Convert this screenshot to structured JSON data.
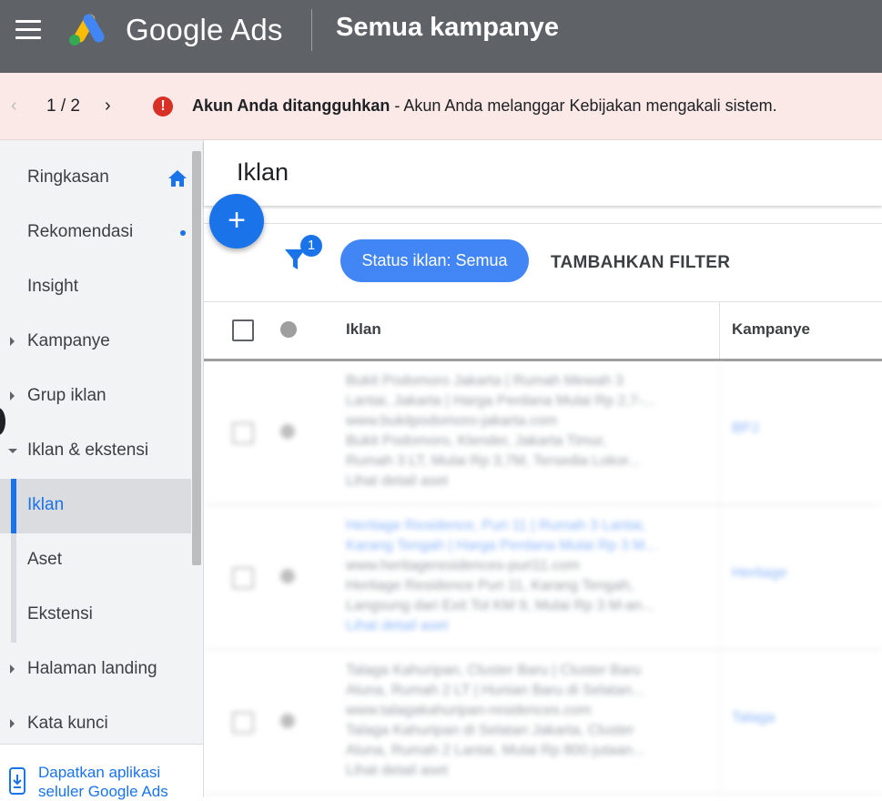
{
  "header": {
    "brand": "Google Ads",
    "page_title": "Semua kampanye",
    "colors": {
      "bar": "#5f6368",
      "logo_blue": "#4285f4",
      "logo_yellow": "#fbbc04",
      "logo_green": "#34a853"
    }
  },
  "alert": {
    "pager": "1 / 2",
    "title": "Akun Anda ditangguhkan",
    "message": " - Akun Anda melanggar Kebijakan mengakali sistem.",
    "color": "#d93025"
  },
  "sidebar": {
    "items": [
      {
        "label": "Ringkasan"
      },
      {
        "label": "Rekomendasi"
      },
      {
        "label": "Insight"
      },
      {
        "label": "Kampanye"
      },
      {
        "label": "Grup iklan"
      },
      {
        "label": "Iklan & ekstensi"
      },
      {
        "label": "Iklan"
      },
      {
        "label": "Aset"
      },
      {
        "label": "Ekstensi"
      },
      {
        "label": "Halaman landing"
      },
      {
        "label": "Kata kunci"
      }
    ],
    "footer": "Dapatkan aplikasi seluler Google Ads"
  },
  "main": {
    "title": "Iklan",
    "fab_icon": "+",
    "filter_count": "1",
    "status_chip": "Status iklan: Semua",
    "add_filter": "TAMBAHKAN FILTER",
    "columns": {
      "ad": "Iklan",
      "campaign": "Kampanye"
    },
    "rows": [
      {
        "lines": [
          "Bukit Podomoro Jakarta | Rumah Mewah 3",
          "Lantai, Jakarta | Harga Perdana Mulai Rp 2,7-...",
          "www.bukitpodomoro-jakarta.com",
          "Bukit Podomoro, Klender, Jakarta Timur,",
          "Rumah 3 LT, Mulai Rp 3,7M, Tersedia Lokor...",
          "Lihat detail aset"
        ],
        "campaign": "BPJ"
      },
      {
        "lines": [
          "Heritage Residence, Puri 11 | Rumah 3 Lantai,",
          "Karang Tengah | Harga Perdana Mulai Rp 3 M...",
          "www.heritageresidences-puri11.com",
          "Heritage Residence Puri 11, Karang Tengah,",
          "Langsung dari Exit Tol KM 9, Mulai Rp 3 M-an...",
          "Lihat detail aset"
        ],
        "campaign": "Heritage"
      },
      {
        "lines": [
          "Talaga Kahuripan, Cluster Baru | Cluster Baru",
          "Aluna, Rumah 2 LT | Hunian Baru di Selatan...",
          "www.talagakahuripan-residences.com",
          "Talaga Kahuripan di Selatan Jakarta, Cluster",
          "Aluna, Rumah 2 Lantai, Mulai Rp 800-jutaan...",
          "Lihat detail aset"
        ],
        "campaign": "Talaga"
      }
    ]
  }
}
